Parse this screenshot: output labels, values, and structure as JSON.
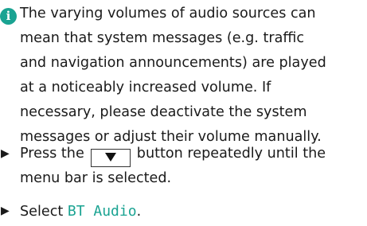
{
  "colors": {
    "accent": "#1aa392",
    "text": "#1a1a1a"
  },
  "note": {
    "icon": "info-icon",
    "icon_glyph": "i",
    "lines": [
      "The varying volumes of audio sources can",
      "mean that system messages (e.g. traffic",
      "and navigation announcements) are played",
      "at a noticeably increased volume. If",
      "necessary, please deactivate the system",
      "messages or adjust their volume manually."
    ]
  },
  "steps": [
    {
      "bullet": "▶",
      "line1_before": "Press the",
      "button_icon": "down-arrow-icon",
      "line1_after": "button repeatedly until the",
      "line2": "menu bar is selected."
    },
    {
      "bullet": "▶",
      "text_before": "Select ",
      "highlight": "BT Audio",
      "text_after": "."
    }
  ]
}
